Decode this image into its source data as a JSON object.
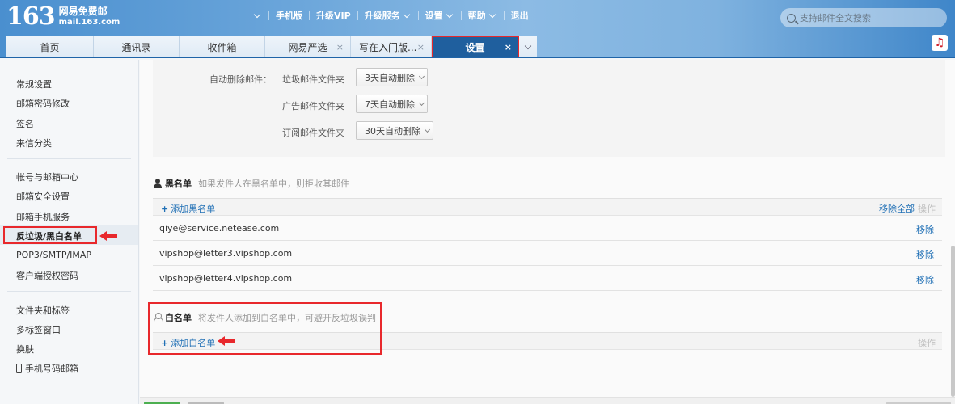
{
  "header": {
    "logo_number": "163",
    "logo_cn": "网易免费邮",
    "logo_url": "mail.163.com",
    "nav": [
      {
        "label": "",
        "has_chevron": true
      },
      {
        "label": "手机版",
        "has_chevron": false
      },
      {
        "label": "升级VIP",
        "has_chevron": false
      },
      {
        "label": "升级服务",
        "has_chevron": true
      },
      {
        "label": "设置",
        "has_chevron": true
      },
      {
        "label": "帮助",
        "has_chevron": true
      },
      {
        "label": "退出",
        "has_chevron": false
      }
    ],
    "search_placeholder": "支持邮件全文搜索"
  },
  "tabs": [
    {
      "label": "首页",
      "closable": false,
      "active": false
    },
    {
      "label": "通讯录",
      "closable": false,
      "active": false
    },
    {
      "label": "收件箱",
      "closable": false,
      "active": false
    },
    {
      "label": "网易严选",
      "closable": true,
      "active": false
    },
    {
      "label": "写在入门版...",
      "closable": true,
      "active": false
    },
    {
      "label": "设置",
      "closable": true,
      "active": true
    }
  ],
  "tab_close_glyph": "×",
  "music_icon_glyph": "♫",
  "sidebar": {
    "groups": [
      [
        "常规设置",
        "邮箱密码修改",
        "签名",
        "来信分类"
      ],
      [
        "帐号与邮箱中心",
        "邮箱安全设置",
        "邮箱手机服务",
        "反垃圾/黑白名单",
        "POP3/SMTP/IMAP",
        "客户端授权密码"
      ],
      [
        "文件夹和标签",
        "多标签窗口",
        "换肤",
        "手机号码邮箱"
      ]
    ],
    "active_item": "反垃圾/黑白名单"
  },
  "auto_delete": {
    "label": "自动删除邮件：",
    "rows": [
      {
        "folder": "垃圾邮件文件夹",
        "value": "3天自动删除"
      },
      {
        "folder": "广告邮件文件夹",
        "value": "7天自动删除"
      },
      {
        "folder": "订阅邮件文件夹",
        "value": "30天自动删除"
      }
    ]
  },
  "blacklist": {
    "title": "黑名单",
    "description": "如果发件人在黑名单中，则拒收其邮件",
    "add_label": "添加黑名单",
    "remove_all_label": "移除全部",
    "op_label": "操作",
    "entries": [
      {
        "email": "qiye@service.netease.com",
        "action": "移除"
      },
      {
        "email": "vipshop@letter3.vipshop.com",
        "action": "移除"
      },
      {
        "email": "vipshop@letter4.vipshop.com",
        "action": "移除"
      }
    ]
  },
  "whitelist": {
    "title": "白名单",
    "description": "将发件人添加到白名单中，可避开反垃圾误判",
    "add_label": "添加白名单",
    "op_label": "操作"
  },
  "colors": {
    "accent_blue": "#1f6fb5",
    "active_tab": "#1f5f9e",
    "annotation_red": "#e8282c"
  }
}
